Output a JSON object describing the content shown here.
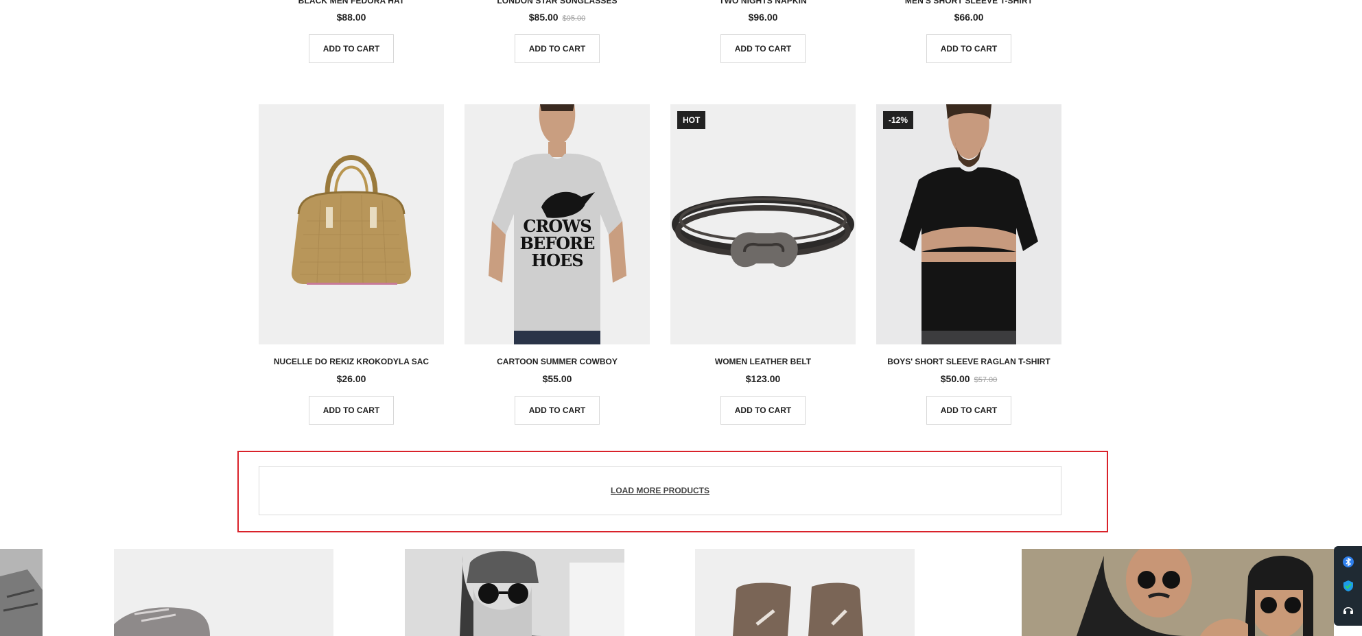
{
  "top_products": [
    {
      "name": "BLACK MEN FEDORA HAT",
      "price": "$88.00",
      "old_price": null,
      "cta": "ADD TO CART"
    },
    {
      "name": "LONDON STAR SUNGLASSES",
      "price": "$85.00",
      "old_price": "$95.00",
      "cta": "ADD TO CART"
    },
    {
      "name": "TWO NIGHTS NAPKIN",
      "price": "$96.00",
      "old_price": null,
      "cta": "ADD TO CART"
    },
    {
      "name": "MEN'S SHORT SLEEVE T-SHIRT",
      "price": "$66.00",
      "old_price": null,
      "cta": "ADD TO CART"
    }
  ],
  "products": [
    {
      "name": "NUCELLE DO REKIZ KROKODYLA SAC",
      "price": "$26.00",
      "old_price": null,
      "badge": null,
      "cta": "ADD TO CART",
      "image": "handbag"
    },
    {
      "name": "CARTOON SUMMER COWBOY",
      "price": "$55.00",
      "old_price": null,
      "badge": null,
      "cta": "ADD TO CART",
      "image": "tshirt-print",
      "print_text": [
        "CROWS",
        "BEFORE",
        "HOES"
      ]
    },
    {
      "name": "WOMEN LEATHER BELT",
      "price": "$123.00",
      "old_price": null,
      "badge": "HOT",
      "cta": "ADD TO CART",
      "image": "bracelet"
    },
    {
      "name": "BOYS' SHORT SLEEVE RAGLAN T-SHIRT",
      "price": "$50.00",
      "old_price": "$57.00",
      "badge": "-12%",
      "cta": "ADD TO CART",
      "image": "black-tshirt"
    }
  ],
  "load_more": {
    "label": "LOAD MORE PRODUCTS"
  },
  "side_widget": {
    "icons": [
      "bluetooth-icon",
      "shield-check-icon",
      "headset-icon"
    ]
  },
  "colors": {
    "highlight": "#d9222a",
    "badge_bg": "#222222",
    "widget_bg": "#1f2a33"
  }
}
